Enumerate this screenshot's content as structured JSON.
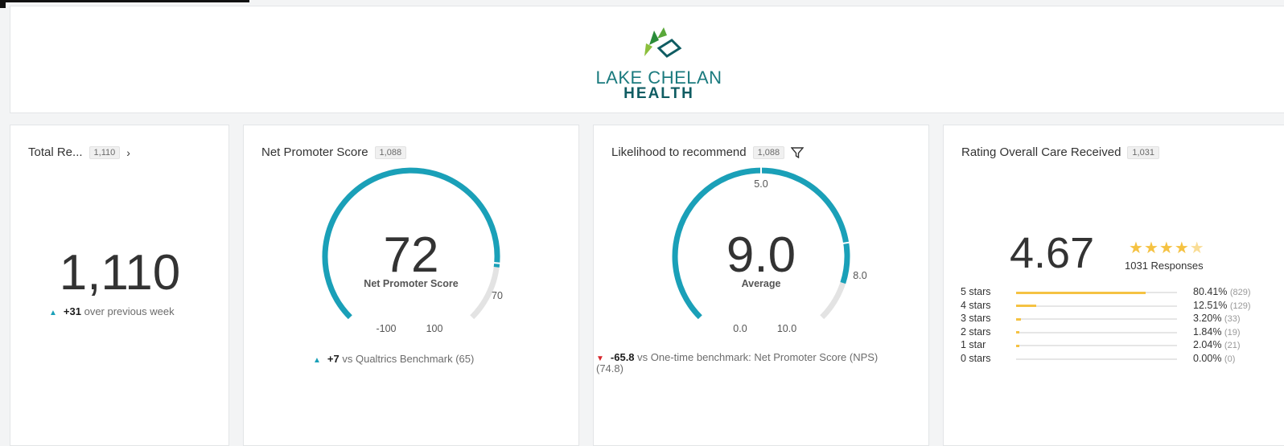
{
  "header": {
    "logo_line1": "LAKE CHELAN",
    "logo_line2": "HEALTH"
  },
  "total_responses": {
    "title": "Total Re...",
    "badge": "1,110",
    "value": "1,110",
    "delta_value": "+31",
    "delta_text": "over previous week"
  },
  "nps": {
    "title": "Net Promoter Score",
    "badge": "1,088",
    "value": "72",
    "label": "Net Promoter Score",
    "min": "-100",
    "max": "100",
    "marker": "70",
    "delta_value": "+7",
    "delta_text": "vs Qualtrics Benchmark (65)",
    "score": 72,
    "benchmark": 70
  },
  "likelihood": {
    "title": "Likelihood to recommend",
    "badge": "1,088",
    "value": "9.0",
    "label": "Average",
    "min": "0.0",
    "max": "10.0",
    "top": "5.0",
    "marker": "8.0",
    "delta_value": "-65.8",
    "delta_text": "vs One-time benchmark: Net Promoter Score (NPS)",
    "delta_text2": "(74.8)",
    "score": 9.0,
    "benchmark": 8.0
  },
  "rating": {
    "title": "Rating Overall Care Received",
    "badge": "1,031",
    "value": "4.67",
    "stars": 4.67,
    "responses": "1031 Responses",
    "rows": [
      {
        "label": "5 stars",
        "pct": "80.41%",
        "count": "(829)",
        "fraction": 0.8041
      },
      {
        "label": "4 stars",
        "pct": "12.51%",
        "count": "(129)",
        "fraction": 0.1251
      },
      {
        "label": "3 stars",
        "pct": "3.20%",
        "count": "(33)",
        "fraction": 0.032
      },
      {
        "label": "2 stars",
        "pct": "1.84%",
        "count": "(19)",
        "fraction": 0.0184
      },
      {
        "label": "1 star",
        "pct": "2.04%",
        "count": "(21)",
        "fraction": 0.0204
      },
      {
        "label": "0 stars",
        "pct": "0.00%",
        "count": "(0)",
        "fraction": 0.0
      }
    ]
  },
  "colors": {
    "gauge": "#1aa0b8",
    "track": "#e3e3e3",
    "star": "#f5c242",
    "up": "#1aa0b8",
    "down": "#d6262c"
  },
  "icons": [
    "chevron-right-icon",
    "filter-icon",
    "triangle-up-icon",
    "triangle-down-icon",
    "star-icon",
    "leaf-logo-icon"
  ]
}
